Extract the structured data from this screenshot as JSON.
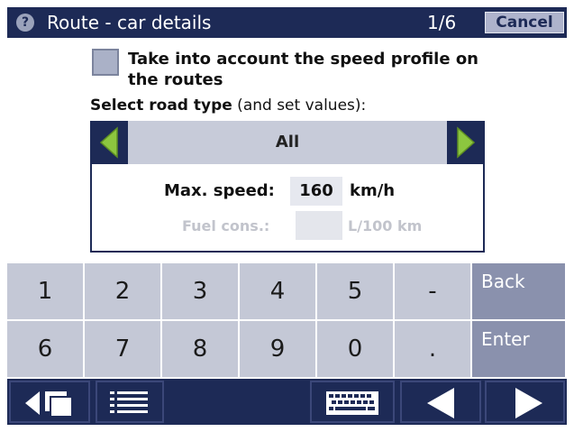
{
  "titlebar": {
    "help_icon": "?",
    "title": "Route - car details",
    "page_indicator": "1/6",
    "cancel_label": "Cancel"
  },
  "content": {
    "speed_profile_checkbox": {
      "checked": false,
      "label": "Take into account the speed profile on the routes"
    },
    "road_type_label_bold": "Select road type",
    "road_type_label_rest": " (and set values):",
    "road_type_selector": {
      "value": "All",
      "left_icon": "arrow-left-icon",
      "right_icon": "arrow-right-icon"
    },
    "max_speed": {
      "label": "Max. speed:",
      "value": "160",
      "unit": "km/h"
    },
    "fuel_consumption": {
      "label": "Fuel cons.:",
      "value": "",
      "unit": "L/100 km",
      "enabled": false
    }
  },
  "keypad": {
    "row1": [
      "1",
      "2",
      "3",
      "4",
      "5",
      "-"
    ],
    "row2": [
      "6",
      "7",
      "8",
      "9",
      "0",
      "."
    ],
    "back_label": "Back",
    "enter_label": "Enter"
  },
  "bottombar": {
    "icons": [
      "switch-window-icon",
      "menu-list-icon",
      "keyboard-icon",
      "previous-arrow-icon",
      "next-arrow-icon"
    ]
  },
  "colors": {
    "navy": "#1d2a56",
    "key_light": "#c4c8d6",
    "key_action": "#8a91ad",
    "arrow_green": "#8cc63f"
  }
}
